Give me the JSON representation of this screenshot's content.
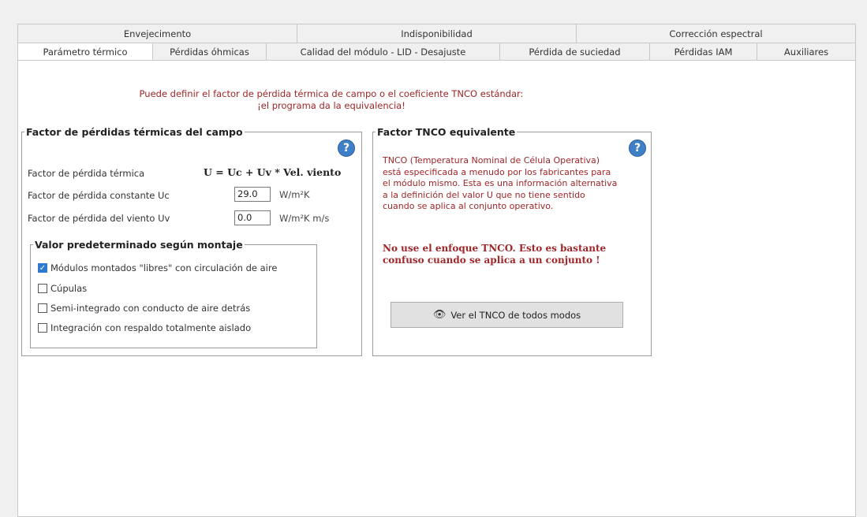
{
  "tabs_row1": [
    "Envejecimento",
    "Indisponibilidad",
    "Corrección espectral"
  ],
  "tabs_row2": [
    "Parámetro térmico",
    "Pérdidas óhmicas",
    "Calidad del módulo - LID - Desajuste",
    "Pérdida de suciedad",
    "Pérdidas IAM",
    "Auxiliares"
  ],
  "note": {
    "line1": "Puede definir el factor de pérdida térmica de campo o el coeficiente TNCO estándar:",
    "line2": "¡el programa da la equivalencia!"
  },
  "thermal_group": {
    "title": "Factor de pérdidas térmicas del campo",
    "loss_factor_label": "Factor de pérdida térmica",
    "formula": "U = Uc + Uv * Vel. viento",
    "uc_label": "Factor de pérdida constante Uc",
    "uc_value": "29.0",
    "uc_unit": "W/m²K",
    "uv_label": "Factor de pérdida del viento Uv",
    "uv_value": "0.0",
    "uv_unit": "W/m²K m/s"
  },
  "mounting_group": {
    "title": "Valor predeterminado según montaje",
    "options": [
      {
        "label": "Módulos montados \"libres\" con circulación de aire",
        "checked": true
      },
      {
        "label": "Cúpulas",
        "checked": false
      },
      {
        "label": "Semi-integrado con conducto de aire detrás",
        "checked": false
      },
      {
        "label": "Integración con respaldo totalmente aislado",
        "checked": false
      }
    ]
  },
  "tnco_group": {
    "title": "Factor TNCO equivalente",
    "description": "TNCO (Temperatura Nominal de Célula Operativa) está especificada a menudo por los fabricantes para el módulo mismo. Esta es una información alternativa a la definición del valor U que no tiene sentido cuando se aplica al conjunto operativo.",
    "warning": "No use el enfoque TNCO. Esto es bastante confuso cuando se aplica a un conjunto !",
    "button_label": "Ver el TNCO de todos modos"
  },
  "help_icon_glyph": "?",
  "check_glyph": "✓",
  "eye_glyph": "👁",
  "colors": {
    "accent": "#3f7fc5",
    "warning_text": "#a0262a",
    "checkbox": "#2e7ad1"
  }
}
